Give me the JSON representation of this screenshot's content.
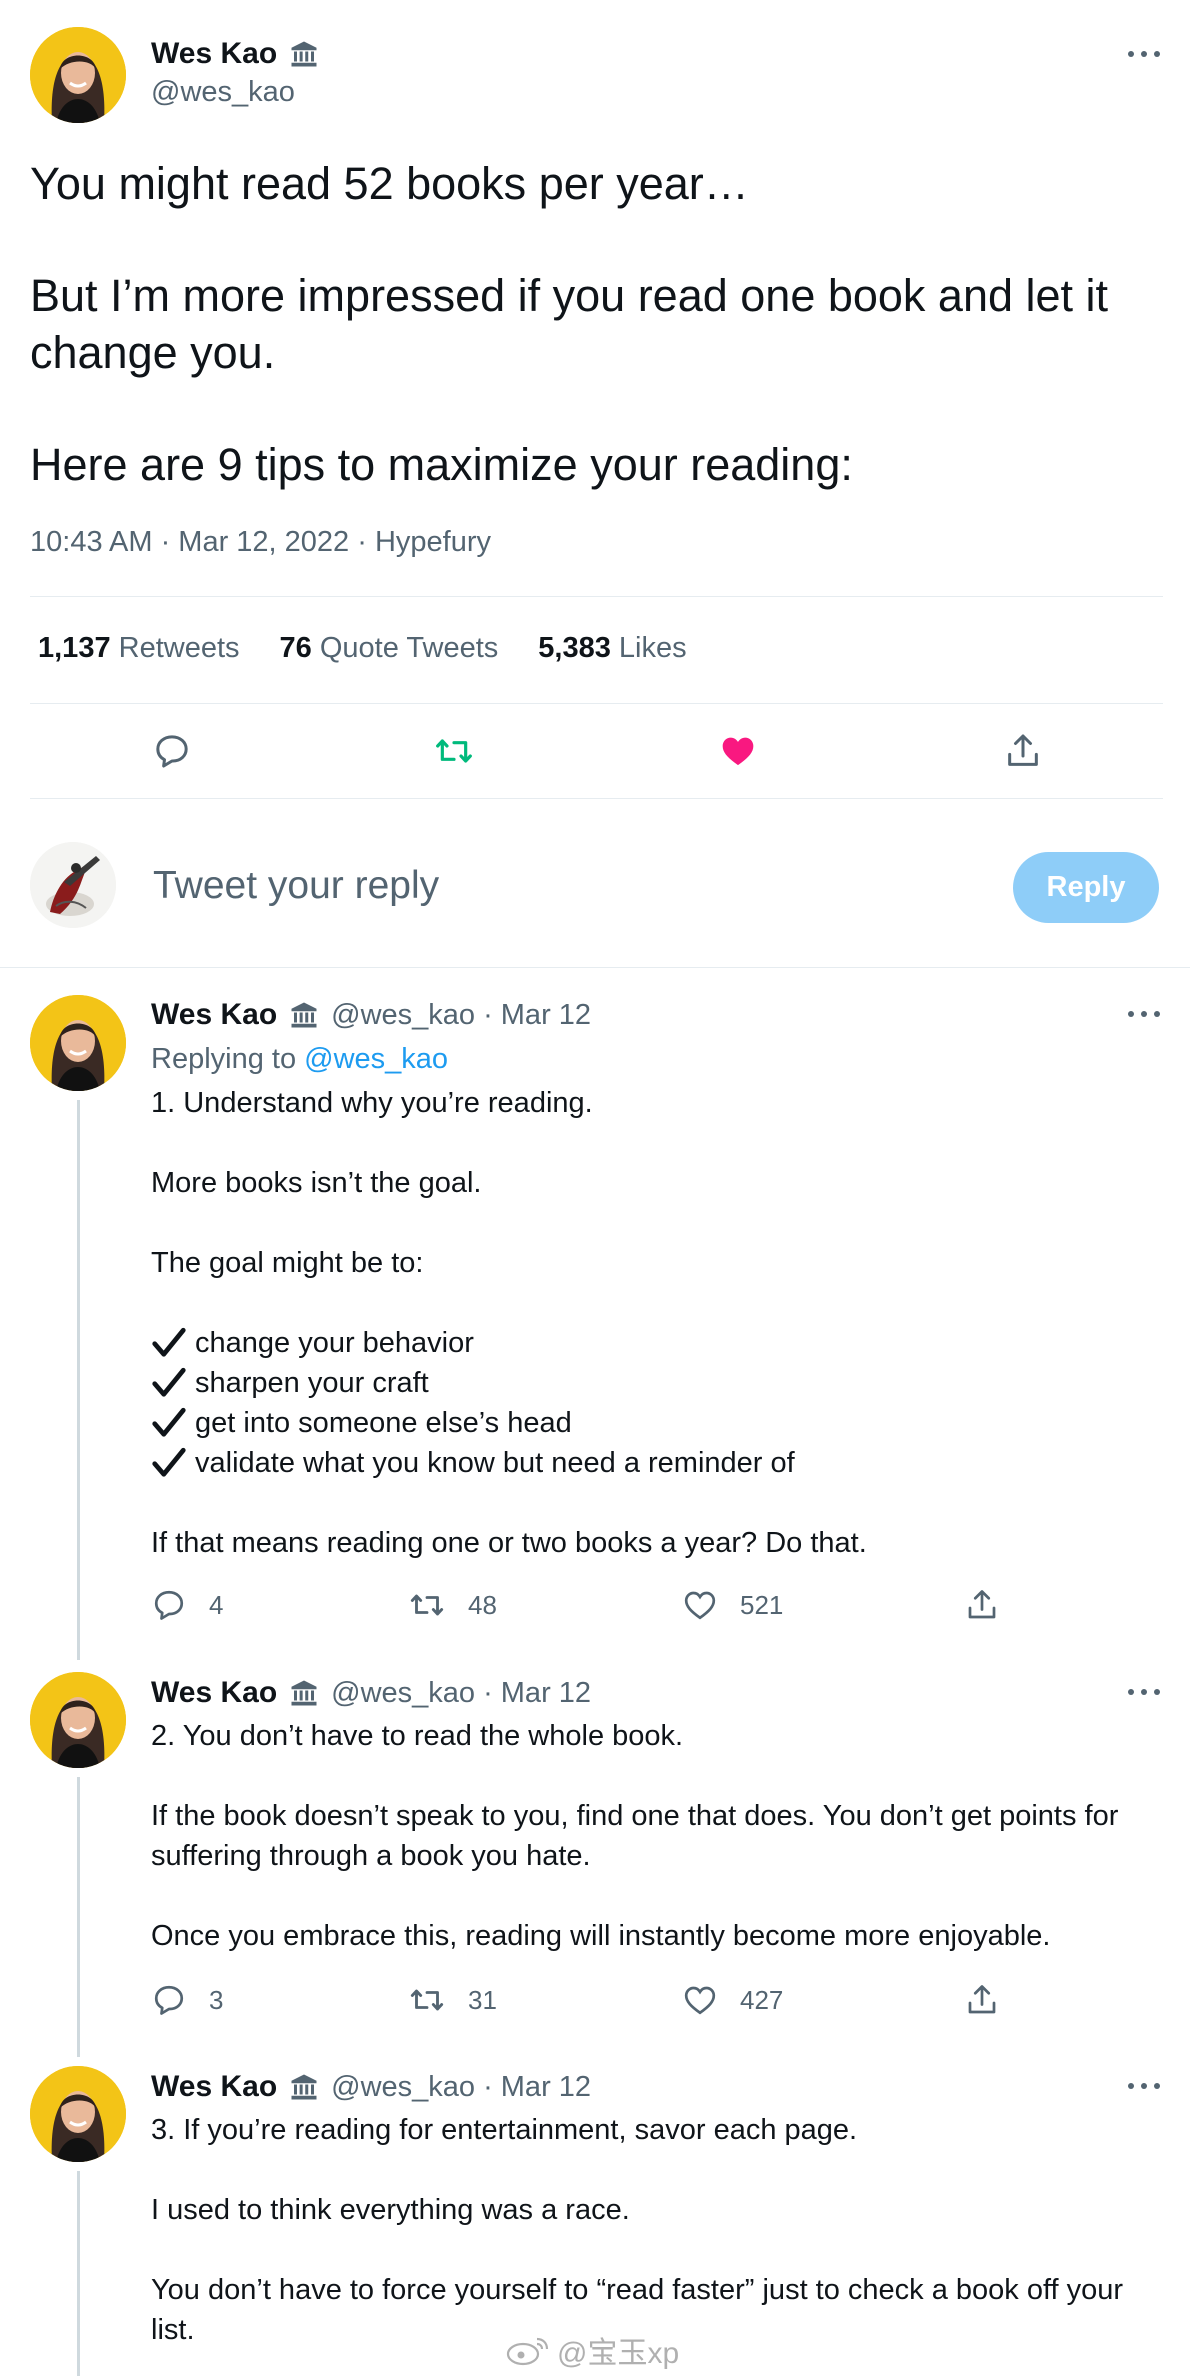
{
  "main_tweet": {
    "author": {
      "name": "Wes Kao",
      "handle": "@wes_kao",
      "verified_icon": "institution-icon"
    },
    "text": {
      "line1": "You might read 52 books per year…",
      "line2": "But I’m more impressed if you read one book and let it change you.",
      "line3": "Here are 9 tips to maximize your reading:"
    },
    "meta": "10:43 AM · Mar 12, 2022 · Hypefury",
    "stats": {
      "retweets_count": "1,137",
      "retweets_label": "Retweets",
      "quotes_count": "76",
      "quotes_label": "Quote Tweets",
      "likes_count": "5,383",
      "likes_label": "Likes"
    },
    "actions": [
      "reply-icon",
      "retweet-icon",
      "like-icon",
      "share-icon"
    ],
    "colors": {
      "retweet_active": "#00ba7c",
      "like_active": "#f91880"
    }
  },
  "composer": {
    "placeholder": "Tweet your reply",
    "reply_button": "Reply",
    "reply_button_color": "#8ecdf8"
  },
  "replies": [
    {
      "name": "Wes Kao",
      "handle": "@wes_kao",
      "date": "· Mar 12",
      "replying_prefix": "Replying to",
      "replying_handle": "@wes_kao",
      "p1": "1. Understand why you’re reading.",
      "p2": "More books isn’t the goal.",
      "p3": "The goal might be to:",
      "checks": [
        "change your behavior",
        "sharpen your craft",
        "get into someone else’s head",
        "validate what you know but need a reminder of"
      ],
      "p4": "If that means reading one or two books a year? Do that.",
      "replies": "4",
      "retweets": "48",
      "likes": "521"
    },
    {
      "name": "Wes Kao",
      "handle": "@wes_kao",
      "date": "· Mar 12",
      "p1": "2. You don’t have to read the whole book.",
      "p2": "If the book doesn’t speak to you, find one that does. You don’t get points for suffering through a book you hate.",
      "p3": "Once you embrace this, reading will instantly become more enjoyable.",
      "replies": "3",
      "retweets": "31",
      "likes": "427"
    },
    {
      "name": "Wes Kao",
      "handle": "@wes_kao",
      "date": "· Mar 12",
      "p1": "3. If you’re reading for entertainment, savor each page.",
      "p2": "I used to think everything was a race.",
      "p3": "You don’t have to force yourself to “read faster” just to check a book off your list."
    }
  ],
  "watermark": "@宝玉xp"
}
